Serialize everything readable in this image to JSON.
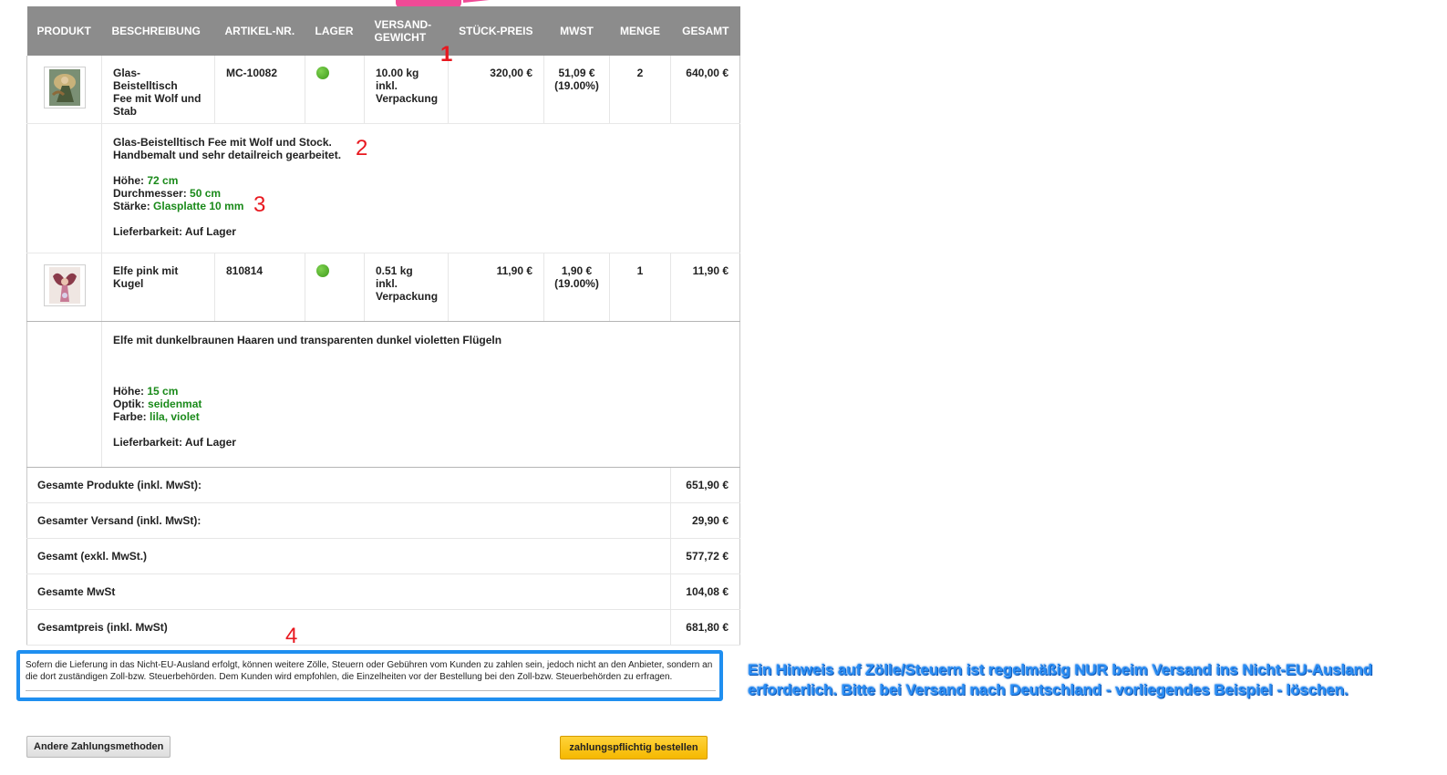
{
  "header": {
    "produkt": "PRODUKT",
    "beschreibung": "BESCHREIBUNG",
    "artikel": "ARTIKEL-NR.",
    "lager": "LAGER",
    "gewicht_1": "VERSAND-",
    "gewicht_2": "GEWICHT",
    "stueckpreis": "STÜCK-PREIS",
    "mwst": "MWST",
    "menge": "MENGE",
    "gesamt": "GESAMT"
  },
  "items": [
    {
      "name_1": "Glas-Beistelltisch",
      "name_2": "Fee mit Wolf und",
      "name_3": "Stab",
      "artikel": "MC-10082",
      "stock_status_color": "#4caf2a",
      "gewicht_1": "10.00 kg",
      "gewicht_2": "inkl.",
      "gewicht_3": "Verpackung",
      "preis": "320,00 €",
      "mwst_1": "51,09 €",
      "mwst_2": "(19.00%)",
      "menge": "2",
      "gesamt": "640,00 €",
      "desc_1": "Glas-Beistelltisch Fee mit Wolf und Stock.",
      "desc_2": "Handbemalt und sehr detailreich gearbeitet.",
      "attrs": [
        {
          "label": "Höhe:",
          "value": "72 cm"
        },
        {
          "label": "Durchmesser:",
          "value": "50 cm"
        },
        {
          "label": "Stärke:",
          "value": "Glasplatte 10 mm"
        }
      ],
      "lieferbarkeit": "Lieferbarkeit: Auf Lager"
    },
    {
      "name_1": "Elfe pink mit",
      "name_2": "Kugel",
      "artikel": "810814",
      "stock_status_color": "#4caf2a",
      "gewicht_1": "0.51 kg",
      "gewicht_2": "inkl.",
      "gewicht_3": "Verpackung",
      "preis": "11,90 €",
      "mwst_1": "1,90 €",
      "mwst_2": "(19.00%)",
      "menge": "1",
      "gesamt": "11,90 €",
      "desc_1": "Elfe mit dunkelbraunen Haaren und transparenten dunkel violetten Flügeln",
      "attrs": [
        {
          "label": "Höhe:",
          "value": "15 cm"
        },
        {
          "label": "Optik:",
          "value": "seidenmat"
        },
        {
          "label": "Farbe:",
          "value": "lila, violet"
        }
      ],
      "lieferbarkeit": "Lieferbarkeit: Auf Lager"
    }
  ],
  "totals": [
    {
      "label": "Gesamte Produkte (inkl. MwSt):",
      "value": "651,90 €"
    },
    {
      "label": "Gesamter Versand (inkl. MwSt):",
      "value": "29,90 €"
    },
    {
      "label": "Gesamt (exkl. MwSt.)",
      "value": "577,72 €"
    },
    {
      "label": "Gesamte MwSt",
      "value": "104,08 €"
    },
    {
      "label": "Gesamtpreis (inkl. MwSt)",
      "value": "681,80 €"
    }
  ],
  "markers": {
    "m1": "1",
    "m2": "2",
    "m3": "3",
    "m4": "4"
  },
  "notice": {
    "text": "Sofern die Lieferung in das Nicht-EU-Ausland erfolgt, können weitere Zölle, Steuern oder Gebühren vom Kunden zu zahlen sein, jedoch nicht an den Anbieter, sondern an die dort zuständigen Zoll-bzw. Steuerbehörden. Dem Kunden wird empfohlen, die Einzelheiten vor der Bestellung bei den Zoll-bzw. Steuerbehörden zu erfragen."
  },
  "annotation": {
    "line_1": "Ein Hinweis auf Zölle/Steuern ist regelmäßig NUR beim Versand ins Nicht-EU-Ausland",
    "line_2": "erforderlich. Bitte bei Versand nach Deutschland - vorliegendes Beispiel - löschen."
  },
  "buttons": {
    "other_payment": "Andere Zahlungsmethoden",
    "order": "zahlungspflichtig bestellen"
  },
  "colors": {
    "header_bg": "#8c8c8c",
    "attr_value": "#1a8a1a",
    "marker": "#e8181f",
    "notice_border": "#1f8ff0",
    "order_button": "#f5b800"
  }
}
